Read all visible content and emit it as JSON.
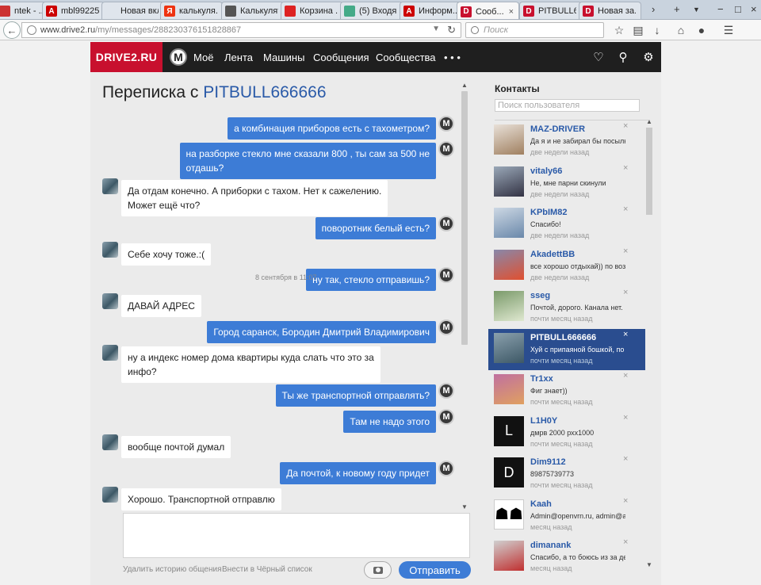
{
  "browser": {
    "tabs": [
      {
        "label": "ntek - ...",
        "icon": "page-icon",
        "color": "#c33",
        "glyph": ""
      },
      {
        "label": "mbl99225...",
        "icon": "acrobat-icon",
        "color": "#c00",
        "glyph": "A"
      },
      {
        "label": "Новая вкладка",
        "icon": "blank-page-icon",
        "color": "#dfe5ec",
        "glyph": ""
      },
      {
        "label": "калькуля...",
        "icon": "yandex-icon",
        "color": "#e31",
        "glyph": "Я"
      },
      {
        "label": "Калькулят...",
        "icon": "calculator-icon",
        "color": "#555",
        "glyph": ""
      },
      {
        "label": "Корзина ...",
        "icon": "cart-icon",
        "color": "#d22",
        "glyph": ""
      },
      {
        "label": "(5) Входя...",
        "icon": "mail-icon",
        "color": "#4a8",
        "glyph": ""
      },
      {
        "label": "Информ...",
        "icon": "acrobat-icon",
        "color": "#c00",
        "glyph": "A"
      },
      {
        "label": "Сооб...",
        "icon": "drive2-icon",
        "color": "#c8102e",
        "glyph": "D",
        "active": true
      },
      {
        "label": "PITBULL6...",
        "icon": "drive2-icon",
        "color": "#c8102e",
        "glyph": "D"
      },
      {
        "label": "Новая за...",
        "icon": "drive2-icon",
        "color": "#c8102e",
        "glyph": "D"
      }
    ],
    "url_host": "www.drive2.ru",
    "url_path": "/my/messages/288230376151828867",
    "search_placeholder": "Поиск"
  },
  "site": {
    "logo": "DRIVE2.RU",
    "avatar_letter": "M",
    "nav": [
      "Моё",
      "Лента",
      "Машины",
      "Сообщения",
      "Сообщества"
    ],
    "more": "• • •"
  },
  "chat": {
    "title_prefix": "Переписка с",
    "peer": "PITBULL666666",
    "me_letter": "M",
    "messages": [
      {
        "from": "me",
        "lines": [
          "а комбинация приборов есть с тахометром?"
        ]
      },
      {
        "from": "me",
        "lines": [
          "на разборке стекло мне сказали 800 , ты сам за 500 не",
          "отдашь?"
        ]
      },
      {
        "from": "peer",
        "lines": [
          "Да отдам конечно. А приборки с тахом. Нет к сажелению.",
          "Может ещё что?"
        ]
      },
      {
        "from": "me",
        "lines": [
          "поворотник белый есть?"
        ]
      },
      {
        "from": "peer",
        "lines": [
          "Себе хочу тоже.:("
        ]
      },
      {
        "from": "me",
        "lines": [
          "ну так, стекло отправишь?"
        ],
        "time": "8 сентября в 11:07"
      },
      {
        "from": "peer",
        "lines": [
          "ДАВАЙ АДРЕС"
        ]
      },
      {
        "from": "me",
        "lines": [
          "Город саранск, Бородин Дмитрий Владимирович"
        ]
      },
      {
        "from": "peer",
        "lines": [
          "ну а индекс номер дома квартиры куда слать что это за",
          "инфо?"
        ]
      },
      {
        "from": "me",
        "lines": [
          "Ты же транспортной отправлять?"
        ]
      },
      {
        "from": "me",
        "lines": [
          "Там не надо этого"
        ]
      },
      {
        "from": "peer",
        "lines": [
          "вообще почтой думал"
        ]
      },
      {
        "from": "me",
        "lines": [
          "Да почтой, к новому году придет"
        ]
      },
      {
        "from": "peer",
        "lines": [
          "Хорошо. Транспортной отправлю"
        ]
      }
    ],
    "clear_history": "Удалить историю общения",
    "blacklist": "Внести в Чёрный список",
    "send": "Отправить"
  },
  "contacts": {
    "title": "Контакты",
    "search_placeholder": "Поиск пользователя",
    "close_glyph": "×",
    "items": [
      {
        "name": "MAZ-DRIVER",
        "preview": "Да я и не забирал бы посылк...",
        "time": "две недели назад",
        "thumb": "person-photo",
        "colors": [
          "#e8e0d8",
          "#a08060"
        ]
      },
      {
        "name": "vitaly66",
        "preview": "Не, мне парни скинули",
        "time": "две недели назад",
        "thumb": "car-photo",
        "colors": [
          "#9aa8b8",
          "#334"
        ]
      },
      {
        "name": "KPbIM82",
        "preview": "Спасибо!",
        "time": "две недели назад",
        "thumb": "car-photo",
        "colors": [
          "#cdd8e4",
          "#6a88aa"
        ]
      },
      {
        "name": "AkadettBB",
        "preview": "все хорошо отдыхай)) по воз...",
        "time": "две недели назад",
        "thumb": "car-photo",
        "colors": [
          "#88a",
          "#e05030"
        ]
      },
      {
        "name": "sseg",
        "preview": "Почтой, дорого. Канала нет.",
        "time": "почти месяц назад",
        "thumb": "car-photo",
        "colors": [
          "#7a9a6a",
          "#dfe8d0"
        ]
      },
      {
        "name": "PITBULL666666",
        "preview": "Хуй с припаяной бошкой, по ...",
        "time": "почти месяц назад",
        "thumb": "car-photo",
        "colors": [
          "#8aa0ad",
          "#3d5866"
        ],
        "active": true
      },
      {
        "name": "Tr1xx",
        "preview": "Фиг знает))",
        "time": "почти месяц назад",
        "thumb": "person-photo",
        "colors": [
          "#c070a0",
          "#e0a060"
        ]
      },
      {
        "name": "L1H0Y",
        "preview": "дмрв 2000 рхх1000",
        "time": "почти месяц назад",
        "thumb": "letter-avatar",
        "letter": "L",
        "colors": [
          "#111",
          "#333"
        ]
      },
      {
        "name": "Dim9112",
        "preview": "89875739773",
        "time": "почти месяц назад",
        "thumb": "letter-avatar",
        "letter": "D",
        "colors": [
          "#111",
          "#222"
        ]
      },
      {
        "name": "Kaah",
        "preview": "Admin@openvrn.ru, admin@ad...",
        "time": "месяц назад",
        "thumb": "icon-people",
        "colors": [
          "#fff",
          "#000"
        ]
      },
      {
        "name": "dimanank",
        "preview": "Спасибо, а то боюсь из за де...",
        "time": "месяц назад",
        "thumb": "car-photo",
        "colors": [
          "#d0d0d0",
          "#c03030"
        ]
      }
    ]
  }
}
